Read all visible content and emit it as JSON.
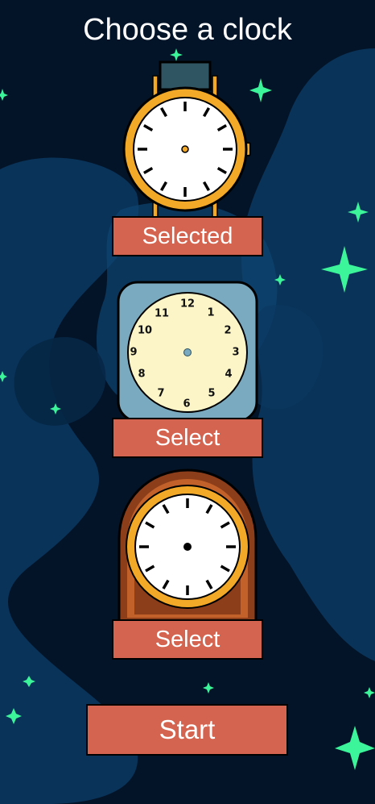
{
  "screen": {
    "title": "Choose a clock"
  },
  "clocks": [
    {
      "icon": "wristwatch-icon",
      "button_label": "Selected",
      "selected": true
    },
    {
      "icon": "wall-clock-icon",
      "button_label": "Select",
      "selected": false,
      "numerals": [
        "12",
        "1",
        "2",
        "3",
        "4",
        "5",
        "6",
        "7",
        "8",
        "9",
        "10",
        "11"
      ]
    },
    {
      "icon": "mantel-clock-icon",
      "button_label": "Select",
      "selected": false
    }
  ],
  "start_button": {
    "label": "Start"
  },
  "colors": {
    "background": "#031428",
    "nebula": "#0c3a63",
    "button": "#d4644f",
    "star": "#3cf59a",
    "watch_case": "#f2a928",
    "wall_clock_frame": "#7aaabf",
    "wall_clock_face": "#fbf5c8",
    "mantel_wood": "#8c3d1a"
  }
}
